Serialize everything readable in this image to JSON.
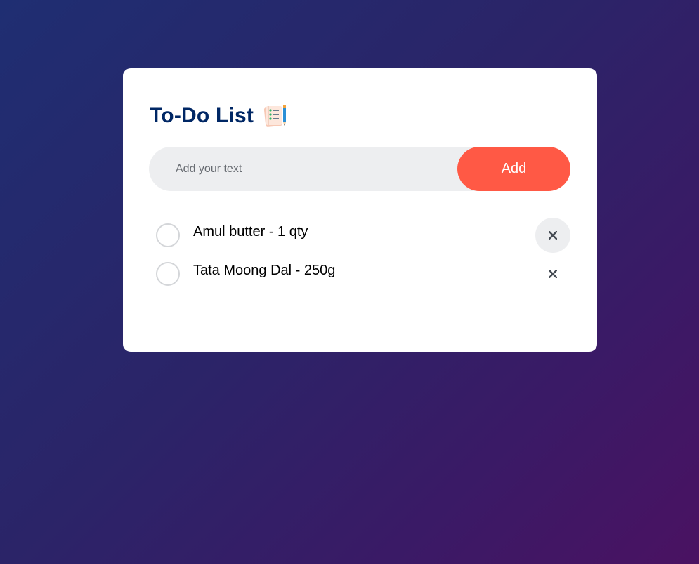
{
  "app": {
    "title": "To-Do List",
    "title_icon": "notepad-checklist-icon"
  },
  "input": {
    "value": "",
    "placeholder": "Add your text"
  },
  "add_button": {
    "label": "Add"
  },
  "todos": [
    {
      "text": "Amul butter - 1 qty",
      "checked": false,
      "delete_icon": "close-icon",
      "hovered": true
    },
    {
      "text": "Tata Moong Dal - 250g",
      "checked": false,
      "delete_icon": "close-icon",
      "hovered": false
    }
  ],
  "colors": {
    "accent": "#ff5945",
    "title": "#002765",
    "input_bg": "#edeef0",
    "card_bg": "#ffffff",
    "background_start": "#1f2e72",
    "background_end": "#4a1262"
  }
}
